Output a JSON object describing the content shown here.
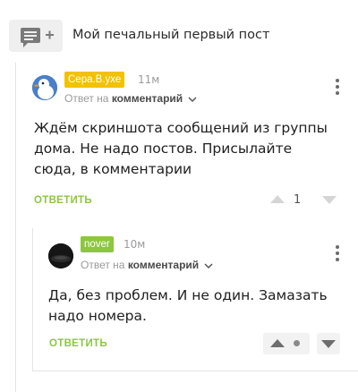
{
  "post": {
    "title": "Мой печальный первый пост",
    "icon": "comment-add-icon"
  },
  "comments": [
    {
      "author": "Сера.В.ухе",
      "badge_color": "#f2c100",
      "avatar": "goose-avatar",
      "time": "11м",
      "reply_prefix": "Ответ на",
      "reply_target": "комментарий",
      "text": "Ждём скриншота сообщений из группы дома. Не надо постов. Присылайте сюда, в комментарии",
      "reply_label": "ОТВЕТИТЬ",
      "score": "1"
    },
    {
      "author": "nover",
      "badge_color": "#8dc63f",
      "avatar": "dark-avatar",
      "time": "10м",
      "reply_prefix": "Ответ на",
      "reply_target": "комментарий",
      "text": "Да, без проблем. И не один. Замазать надо номера.",
      "reply_label": "ОТВЕТИТЬ"
    }
  ],
  "colors": {
    "accent_green": "#8dc63f",
    "accent_yellow": "#f2c100"
  }
}
